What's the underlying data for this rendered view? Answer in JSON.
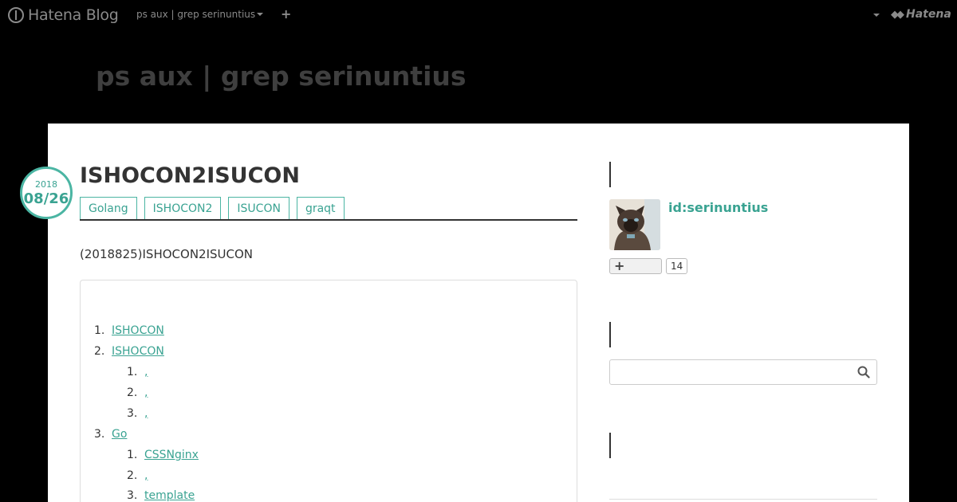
{
  "globalbar": {
    "logo": "Hatena Blog",
    "blog_select": "ps aux | grep serinuntius",
    "add_label": "+",
    "brand_right": "Hatena"
  },
  "blog": {
    "title": "ps aux | grep serinuntius"
  },
  "entry": {
    "date_year": "2018",
    "date_md": "08/26",
    "title": "ISHOCON2ISUCON",
    "categories": [
      "Golang",
      "ISHOCON2",
      "ISUCON",
      "graqt"
    ],
    "lead": "(2018825)ISHOCON2ISUCON"
  },
  "toc": {
    "items": [
      {
        "num": "1.",
        "text": "ISHOCON"
      },
      {
        "num": "2.",
        "text": "ISHOCON"
      },
      {
        "num": "1.",
        "text": ","
      },
      {
        "num": "2.",
        "text": ","
      },
      {
        "num": "3.",
        "text": ","
      },
      {
        "num": "3.",
        "text": "Go"
      },
      {
        "num": "1.",
        "text": "CSSNginx"
      },
      {
        "num": "2.",
        "text": ","
      },
      {
        "num": "3.",
        "text": "template"
      }
    ]
  },
  "sidebar": {
    "profile_id": "id:serinuntius",
    "subscribe_label": "+",
    "subscriber_count": "14",
    "search_placeholder": ""
  },
  "colors": {
    "accent": "#3aa392",
    "background": "#000000",
    "content": "#ffffff"
  }
}
